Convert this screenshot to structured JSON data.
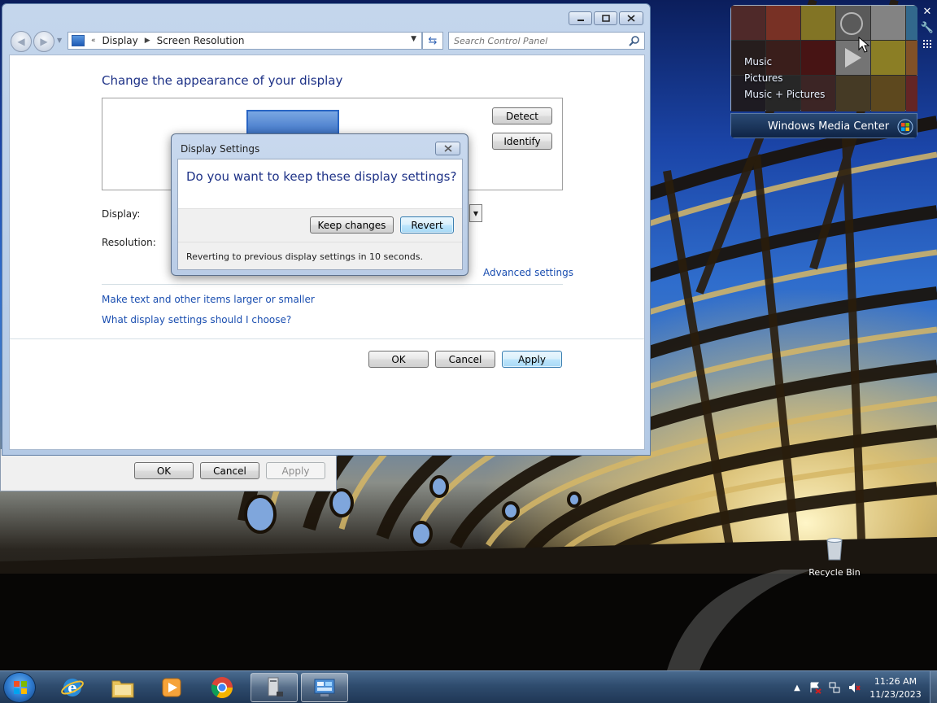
{
  "cp_window": {
    "breadcrumb": [
      "Display",
      "Screen Resolution"
    ],
    "breadcrumb_overflow": "«",
    "search_placeholder": "Search Control Panel",
    "page_title": "Change the appearance of your display",
    "detect_label": "Detect",
    "identify_label": "Identify",
    "display_label": "Display:",
    "resolution_label": "Resolution:",
    "advanced_link": "Advanced settings",
    "link_text_size": "Make text and other items larger or smaller",
    "link_help": "What display settings should I choose?",
    "ok_label": "OK",
    "cancel_label": "Cancel",
    "apply_label": "Apply"
  },
  "back_dialog": {
    "ok_label": "OK",
    "cancel_label": "Cancel",
    "apply_label": "Apply"
  },
  "modal": {
    "title": "Display Settings",
    "question": "Do you want to keep these display settings?",
    "keep_label": "Keep changes",
    "revert_label": "Revert",
    "revert_note": "Reverting to previous display settings in 10 seconds."
  },
  "gadget": {
    "menu_items": [
      "Music",
      "Pictures",
      "Music + Pictures"
    ],
    "name": "Windows Media Center"
  },
  "desktop": {
    "recycle_bin_label": "Recycle Bin"
  },
  "taskbar": {
    "time": "11:26 AM",
    "date": "11/23/2023"
  },
  "colors": {
    "link_blue": "#1a4eb0",
    "title_blue": "#1e3287",
    "default_button_border": "#3c7fb1"
  }
}
